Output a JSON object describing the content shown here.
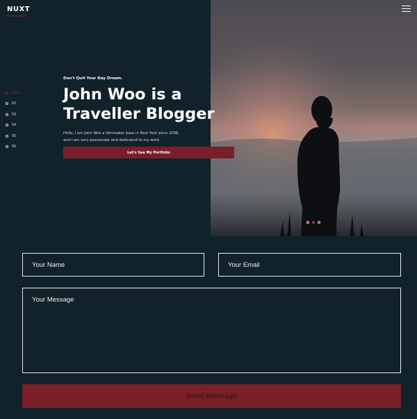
{
  "brand": {
    "name": "NUXT",
    "tagline": "Vuetemplates"
  },
  "slide_nav": {
    "items": [
      {
        "label": "Intro",
        "active": true
      },
      {
        "label": "02",
        "active": false
      },
      {
        "label": "03",
        "active": false
      },
      {
        "label": "04",
        "active": false
      },
      {
        "label": "05",
        "active": false
      },
      {
        "label": "06",
        "active": false
      }
    ]
  },
  "hero": {
    "eyebrow": "Don't Quit Your Day Dream.",
    "headline_line1": "John Woo is a",
    "headline_line2": "Traveller Blogger",
    "intro_line1": "Hello, I am John Woo a filmmaker base in New York since 2008,",
    "intro_line2": "and i am very passionate and dedicated to my work.",
    "cta_label": "Let's See My Portfolio",
    "image_subject": "man-silhouette-at-sunset-photo"
  },
  "carousel": {
    "slide_count": 3,
    "active_index": 1
  },
  "menu": {
    "icon": "hamburger-icon"
  },
  "contact_form": {
    "name_placeholder": "Your Name",
    "email_placeholder": "Your Email",
    "message_placeholder": "Your Message",
    "submit_label": "Send Message"
  },
  "colors": {
    "background": "#11222a",
    "accent": "#7a1f29",
    "active_dot": "#b2323f",
    "text": "#ffffff"
  }
}
